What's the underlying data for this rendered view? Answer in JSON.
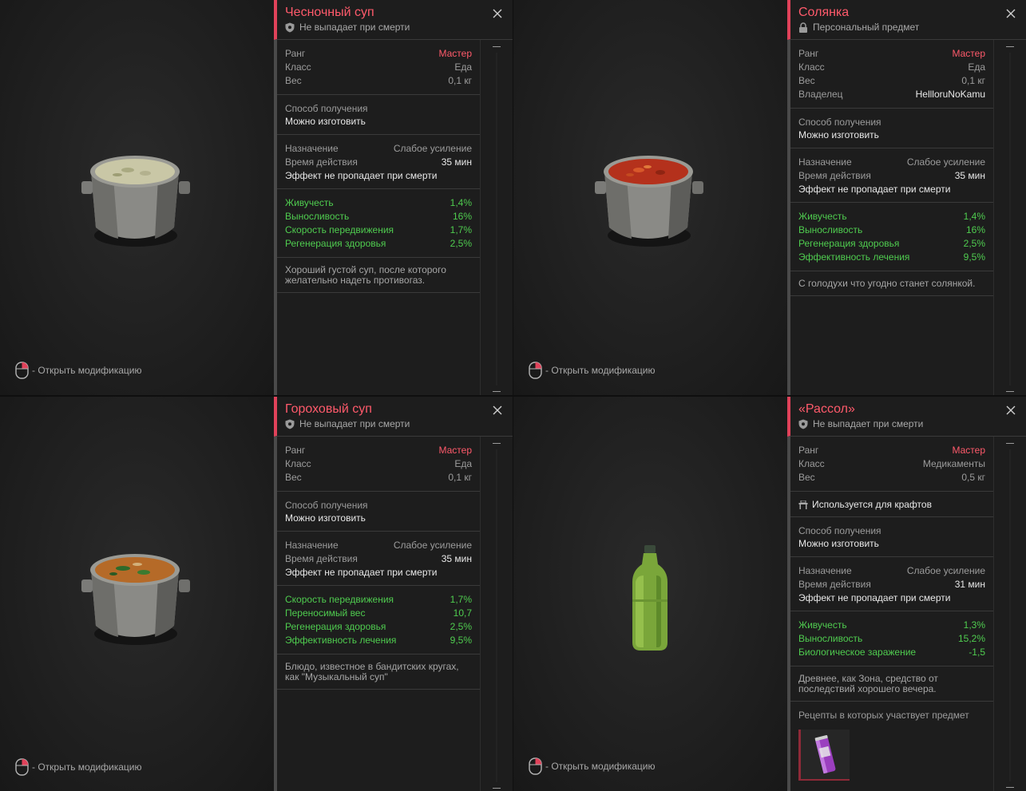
{
  "cards": [
    {
      "title": "Чесночный суп",
      "subtitle": "Не выпадает при смерти",
      "stats": [
        {
          "label": "Ранг",
          "value": "Мастер",
          "style": "red"
        },
        {
          "label": "Класс",
          "value": "Еда"
        },
        {
          "label": "Вес",
          "value": "0,1 кг"
        }
      ],
      "obtain_label": "Способ получения",
      "obtain_value": "Можно изготовить",
      "purpose_label": "Назначение",
      "purpose_value": "Слабое усиление",
      "duration_label": "Время действия",
      "duration_value": "35 мин",
      "effect_note": "Эффект не пропадает при смерти",
      "effects": [
        {
          "label": "Живучесть",
          "value": "1,4%"
        },
        {
          "label": "Выносливость",
          "value": "16%"
        },
        {
          "label": "Скорость передвижения",
          "value": "1,7%"
        },
        {
          "label": "Регенерация здоровья",
          "value": "2,5%"
        }
      ],
      "description": "Хороший густой суп, после которого желательно надеть противогаз.",
      "hint": "- Открыть модификацию"
    },
    {
      "title": "Солянка",
      "subtitle": "Персональный предмет",
      "stats": [
        {
          "label": "Ранг",
          "value": "Мастер",
          "style": "red"
        },
        {
          "label": "Класс",
          "value": "Еда"
        },
        {
          "label": "Вес",
          "value": "0,1 кг"
        },
        {
          "label": "Владелец",
          "value": "HellloruNoKamu",
          "style": "white"
        }
      ],
      "obtain_label": "Способ получения",
      "obtain_value": "Можно изготовить",
      "purpose_label": "Назначение",
      "purpose_value": "Слабое усиление",
      "duration_label": "Время действия",
      "duration_value": "35 мин",
      "effect_note": "Эффект не пропадает при смерти",
      "effects": [
        {
          "label": "Живучесть",
          "value": "1,4%"
        },
        {
          "label": "Выносливость",
          "value": "16%"
        },
        {
          "label": "Регенерация здоровья",
          "value": "2,5%"
        },
        {
          "label": "Эффективность лечения",
          "value": "9,5%"
        }
      ],
      "description": "С голодухи что угодно станет солянкой.",
      "hint": "- Открыть модификацию"
    },
    {
      "title": "Гороховый суп",
      "subtitle": "Не выпадает при смерти",
      "stats": [
        {
          "label": "Ранг",
          "value": "Мастер",
          "style": "red"
        },
        {
          "label": "Класс",
          "value": "Еда"
        },
        {
          "label": "Вес",
          "value": "0,1 кг"
        }
      ],
      "obtain_label": "Способ получения",
      "obtain_value": "Можно изготовить",
      "purpose_label": "Назначение",
      "purpose_value": "Слабое усиление",
      "duration_label": "Время действия",
      "duration_value": "35 мин",
      "effect_note": "Эффект не пропадает при смерти",
      "effects": [
        {
          "label": "Скорость передвижения",
          "value": "1,7%"
        },
        {
          "label": "Переносимый вес",
          "value": "10,7"
        },
        {
          "label": "Регенерация здоровья",
          "value": "2,5%"
        },
        {
          "label": "Эффективность лечения",
          "value": "9,5%"
        }
      ],
      "description": "Блюдо, известное в бандитских кругах, как \"Музыкальный суп\"",
      "hint": "- Открыть модификацию"
    },
    {
      "title": "«Рассол»",
      "subtitle": "Не выпадает при смерти",
      "stats": [
        {
          "label": "Ранг",
          "value": "Мастер",
          "style": "red"
        },
        {
          "label": "Класс",
          "value": "Медикаменты"
        },
        {
          "label": "Вес",
          "value": "0,5 кг"
        }
      ],
      "craft_flag": "Используется для крафтов",
      "obtain_label": "Способ получения",
      "obtain_value": "Можно изготовить",
      "purpose_label": "Назначение",
      "purpose_value": "Слабое усиление",
      "duration_label": "Время действия",
      "duration_value": "31 мин",
      "effect_note": "Эффект не пропадает при смерти",
      "effects": [
        {
          "label": "Живучесть",
          "value": "1,3%"
        },
        {
          "label": "Выносливость",
          "value": "15,2%"
        },
        {
          "label": "Биологическое заражение",
          "value": "-1,5"
        }
      ],
      "description": "Древнее, как Зона, средство от последствий хорошего вечера.",
      "recipes_label": "Рецепты в которых участвует предмет",
      "hint": "- Открыть модификацию"
    }
  ],
  "colors": {
    "accent": "#e0425a",
    "title": "#ff5a6b",
    "green": "#4fcc4f"
  }
}
